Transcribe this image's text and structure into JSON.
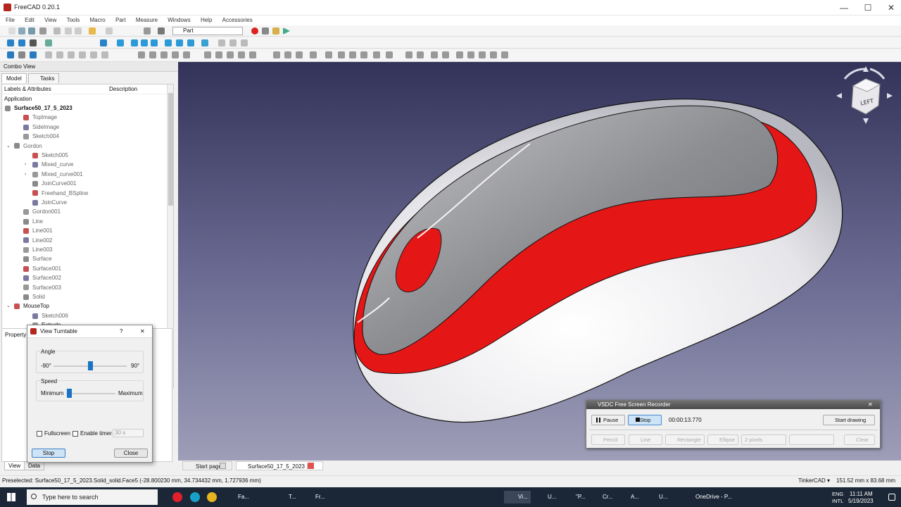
{
  "window": {
    "title": "FreeCAD 0.20.1",
    "min": "—",
    "max": "☐",
    "close": "✕"
  },
  "menu": [
    "File",
    "Edit",
    "View",
    "Tools",
    "Macro",
    "Part",
    "Measure",
    "Windows",
    "Help",
    "Accessories"
  ],
  "toolbar": {
    "workbench": "Part"
  },
  "combo": {
    "title": "Combo View",
    "tabs": [
      "Model",
      "Tasks"
    ],
    "col_labels": "Labels & Attributes",
    "col_desc": "Description",
    "application": "Application",
    "tree": [
      {
        "label": "Surface50_17_5_2023",
        "bold": true,
        "indent": 0,
        "exp": "v"
      },
      {
        "label": "TopImage",
        "indent": 2,
        "grey": true
      },
      {
        "label": "SideImage",
        "indent": 2,
        "grey": true
      },
      {
        "label": "Sketch004",
        "indent": 2,
        "grey": true
      },
      {
        "label": "Gordon",
        "indent": 1,
        "grey": true,
        "exp": "v"
      },
      {
        "label": "Sketch005",
        "indent": 3,
        "grey": true
      },
      {
        "label": "Mixed_curve",
        "indent": 3,
        "grey": true,
        "exp": ">"
      },
      {
        "label": "Mixed_curve001",
        "indent": 3,
        "grey": true,
        "exp": ">"
      },
      {
        "label": "JoinCurve001",
        "indent": 3,
        "grey": true
      },
      {
        "label": "Freehand_BSpline",
        "indent": 3,
        "grey": true
      },
      {
        "label": "JoinCurve",
        "indent": 3,
        "grey": true
      },
      {
        "label": "Gordon001",
        "indent": 2,
        "grey": true
      },
      {
        "label": "Line",
        "indent": 2,
        "grey": true
      },
      {
        "label": "Line001",
        "indent": 2,
        "grey": true
      },
      {
        "label": "Line002",
        "indent": 2,
        "grey": true
      },
      {
        "label": "Line003",
        "indent": 2,
        "grey": true
      },
      {
        "label": "Surface",
        "indent": 2,
        "grey": true
      },
      {
        "label": "Surface001",
        "indent": 2,
        "grey": true
      },
      {
        "label": "Surface002",
        "indent": 2,
        "grey": true
      },
      {
        "label": "Surface003",
        "indent": 2,
        "grey": true
      },
      {
        "label": "Solid",
        "indent": 2,
        "grey": true
      },
      {
        "label": "MouseTop",
        "indent": 1,
        "exp": "v"
      },
      {
        "label": "Sketch006",
        "indent": 3,
        "grey": true
      },
      {
        "label": "Extrude",
        "indent": 3
      }
    ],
    "property_label": "Property"
  },
  "turntable": {
    "title": "View Turntable",
    "help": "?",
    "close_x": "✕",
    "angle_label": "Angle",
    "angle_min": "-90°",
    "angle_max": "90°",
    "angle_value": 0.5,
    "speed_label": "Speed",
    "speed_min": "Minimum",
    "speed_max": "Maximum",
    "speed_value": 0.05,
    "fullscreen": "Fullscreen",
    "enable_timer": "Enable timer",
    "timer_value": "30 s",
    "stop": "Stop",
    "close": "Close"
  },
  "bottom_tabs_left": [
    "View",
    "Data"
  ],
  "doc_tabs": [
    "Start page",
    "Surface50_17_5_2023 : 1"
  ],
  "navcube": {
    "face": "LEFT"
  },
  "recorder": {
    "title": "VSDC Free Screen Recorder",
    "close_x": "✕",
    "pause": "Pause",
    "stop": "Stop",
    "time": "00:00:13.770",
    "start_drawing": "Start drawing",
    "pencil": "Pencil",
    "line": "Line",
    "rectangle": "Rectangle",
    "ellipse": "Ellipse",
    "pixels": "2 pixels",
    "clear": "Clear"
  },
  "status": {
    "preselected": "Preselected: Surface50_17_5_2023.Solid_solid.Face5 (-28.800230 mm, 34.734432 mm, 1.727936 mm)",
    "nav_style": "TinkerCAD ▾",
    "dimensions": "151.52 mm x 83.68 mm"
  },
  "taskbar": {
    "search": "Type here to search",
    "items": [
      "Fa...",
      "T...",
      "Fr...",
      "Vi...",
      "U...",
      "\"P...",
      "Cr...",
      "A...",
      "U..."
    ],
    "onedrive": "OneDrive - P...",
    "lang1": "ENG",
    "lang2": "INTL",
    "time": "11:11 AM",
    "date": "5/19/2023"
  },
  "colors": {
    "accent_red": "#e41616",
    "mouse_white": "#e9e9ee",
    "bg_top": "#33335a",
    "bg_bottom": "#9e9eb8"
  }
}
